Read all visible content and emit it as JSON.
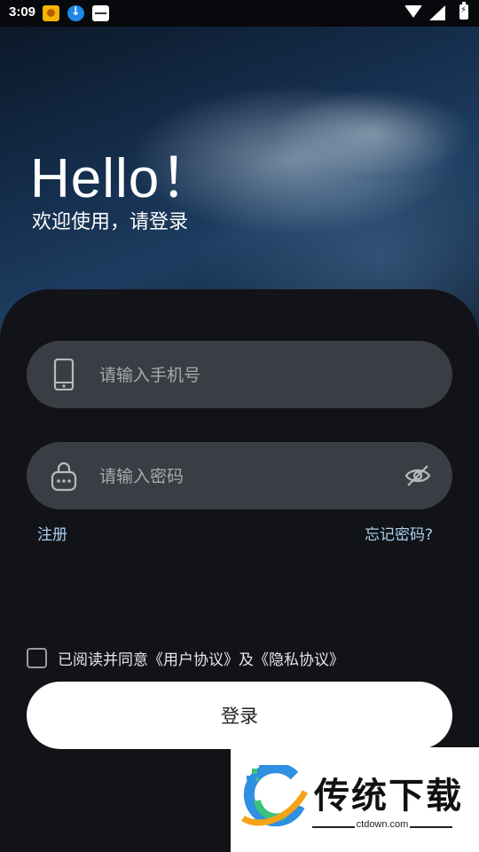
{
  "status_bar": {
    "time": "3:09",
    "icons": [
      "app-notification-icon",
      "download-icon",
      "app-notification-icon",
      "wifi-icon",
      "signal-icon",
      "battery-charging-icon"
    ]
  },
  "hero": {
    "title": "Hello！",
    "subtitle": "欢迎使用，请登录"
  },
  "form": {
    "phone_placeholder": "请输入手机号",
    "password_placeholder": "请输入密码",
    "register_label": "注册",
    "forgot_label": "忘记密码?",
    "agreement_text": "已阅读并同意《用户协议》及《隐私协议》",
    "agreement_checked": false,
    "login_label": "登录"
  },
  "watermark": {
    "title": "传统下载",
    "url": "ctdown.com"
  },
  "colors": {
    "background": "#121318",
    "field": "#3b3d44",
    "link": "#a9d0f0",
    "button": "#ffffff"
  }
}
